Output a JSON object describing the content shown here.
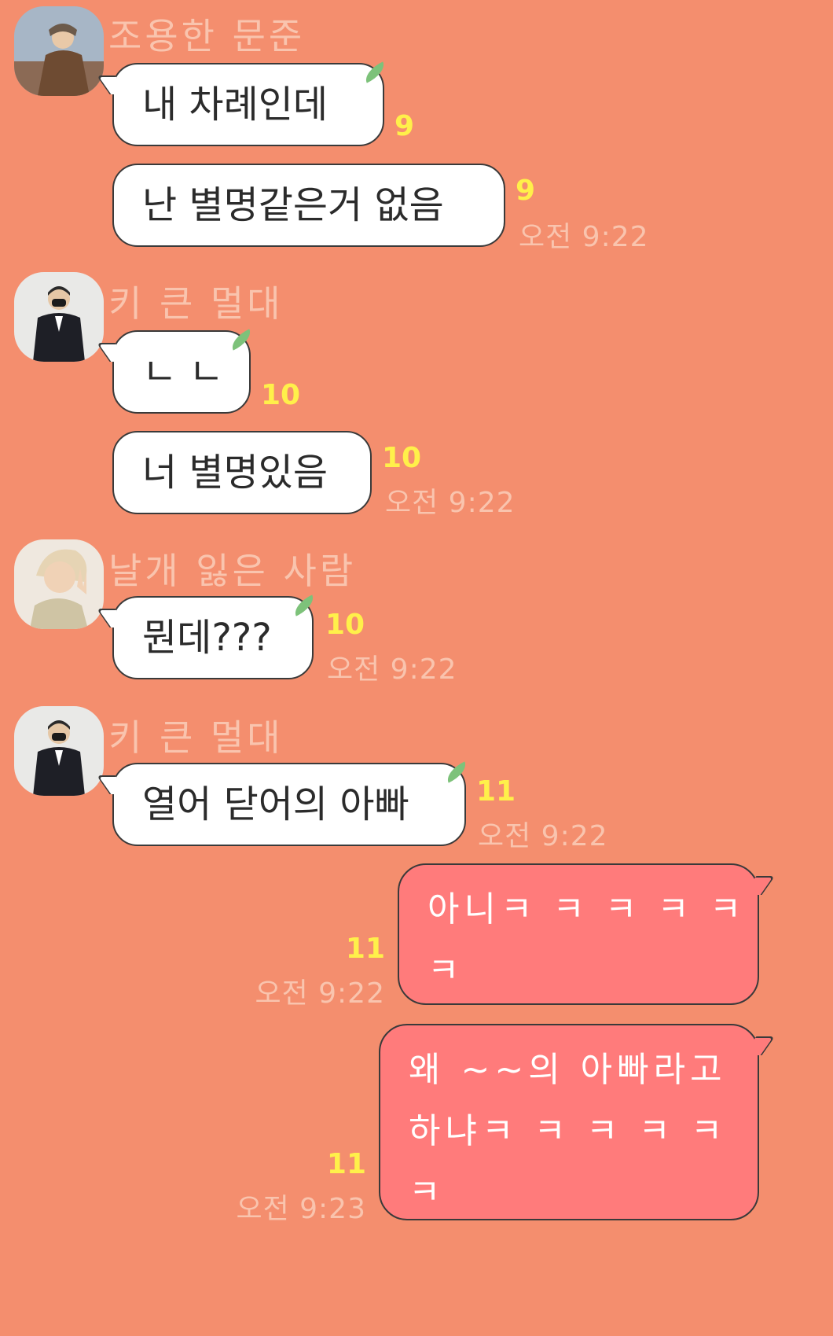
{
  "messages": {
    "m1": {
      "sender": "조용한 문준",
      "lines": [
        {
          "text": "내 차례인데",
          "count": "9"
        },
        {
          "text": "난 별명같은거 없음",
          "count": "9",
          "time": "오전 9:22"
        }
      ]
    },
    "m2": {
      "sender": "키 큰 멀대",
      "lines": [
        {
          "text": "ㄴ ㄴ",
          "count": "10"
        },
        {
          "text": "너 별명있음",
          "count": "10",
          "time": "오전 9:22"
        }
      ]
    },
    "m3": {
      "sender": "날개 잃은 사람",
      "lines": [
        {
          "text": "뭔데???",
          "count": "10",
          "time": "오전 9:22"
        }
      ]
    },
    "m4": {
      "sender": "키 큰 멀대",
      "lines": [
        {
          "text": "열어 닫어의 아빠",
          "count": "11",
          "time": "오전 9:22"
        }
      ]
    },
    "mine1": {
      "line1": "아니ㅋ ㅋ ㅋ ㅋ ㅋ",
      "line2": "ㅋ",
      "count": "11",
      "time": "오전 9:22"
    },
    "mine2": {
      "line1": "왜 ~~의 아빠라고",
      "line2": "하냐ㅋ ㅋ ㅋ ㅋ ㅋ",
      "line3": "ㅋ",
      "count": "11",
      "time": "오전 9:23"
    }
  }
}
